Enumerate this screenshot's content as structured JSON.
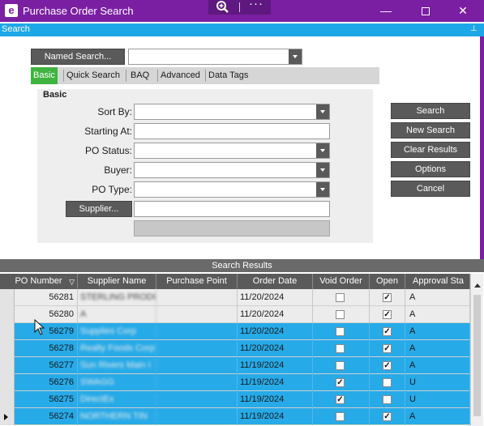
{
  "window": {
    "title": "Purchase Order Search",
    "app_icon_letter": "e",
    "more_glyph": "···",
    "min_glyph": "—",
    "close_glyph": "✕",
    "title_color": "#7a1fa2"
  },
  "subbar": {
    "title": "Search",
    "pin_glyph": "⊥",
    "color": "#1ea7e8"
  },
  "named_search": {
    "button_label": "Named Search...",
    "value": ""
  },
  "tabs": [
    "Basic",
    "Quick Search",
    "BAQ",
    "Advanced",
    "Data Tags"
  ],
  "active_tab": "Basic",
  "basic": {
    "title": "Basic",
    "sort_by": {
      "label": "Sort By:",
      "value": ""
    },
    "starting_at": {
      "label": "Starting At:",
      "value": ""
    },
    "po_status": {
      "label": "PO Status:",
      "value": ""
    },
    "buyer": {
      "label": "Buyer:",
      "value": ""
    },
    "po_type": {
      "label": "PO Type:",
      "value": ""
    },
    "supplier": {
      "button_label": "Supplier...",
      "value": ""
    }
  },
  "actions": {
    "search": "Search",
    "new_search": "New Search",
    "clear_results": "Clear Results",
    "options": "Options",
    "cancel": "Cancel"
  },
  "results": {
    "title": "Search Results",
    "columns": [
      "PO Number",
      "Supplier Name",
      "Purchase Point",
      "Order Date",
      "Void Order",
      "Open",
      "Approval Sta"
    ],
    "rows": [
      {
        "po": "56281",
        "supplier": "STERLING PRODU",
        "point": "",
        "date": "11/20/2024",
        "void": false,
        "open": true,
        "approval": "A",
        "selected": false,
        "current": false
      },
      {
        "po": "56280",
        "supplier": "A",
        "point": "",
        "date": "11/20/2024",
        "void": false,
        "open": true,
        "approval": "A",
        "selected": false,
        "current": false
      },
      {
        "po": "56279",
        "supplier": "Supplies Corp",
        "point": "",
        "date": "11/20/2024",
        "void": false,
        "open": true,
        "approval": "A",
        "selected": true,
        "current": false
      },
      {
        "po": "56278",
        "supplier": "Realty Foods Corp",
        "point": "",
        "date": "11/20/2024",
        "void": false,
        "open": true,
        "approval": "A",
        "selected": true,
        "current": false
      },
      {
        "po": "56277",
        "supplier": "Sun Rivers Main I",
        "point": "",
        "date": "11/19/2024",
        "void": false,
        "open": true,
        "approval": "A",
        "selected": true,
        "current": false
      },
      {
        "po": "56276",
        "supplier": "SWAGG",
        "point": "",
        "date": "11/19/2024",
        "void": true,
        "open": false,
        "approval": "U",
        "selected": true,
        "current": false
      },
      {
        "po": "56275",
        "supplier": "DirectEx",
        "point": "",
        "date": "11/19/2024",
        "void": true,
        "open": false,
        "approval": "U",
        "selected": true,
        "current": false
      },
      {
        "po": "56274",
        "supplier": "NORTHERN TIN",
        "point": "",
        "date": "11/19/2024",
        "void": false,
        "open": true,
        "approval": "A",
        "selected": true,
        "current": true
      }
    ]
  },
  "icons": {
    "zoom": "zoom-in-icon",
    "filter": "filter-icon",
    "cursor": "mouse-cursor-icon"
  }
}
